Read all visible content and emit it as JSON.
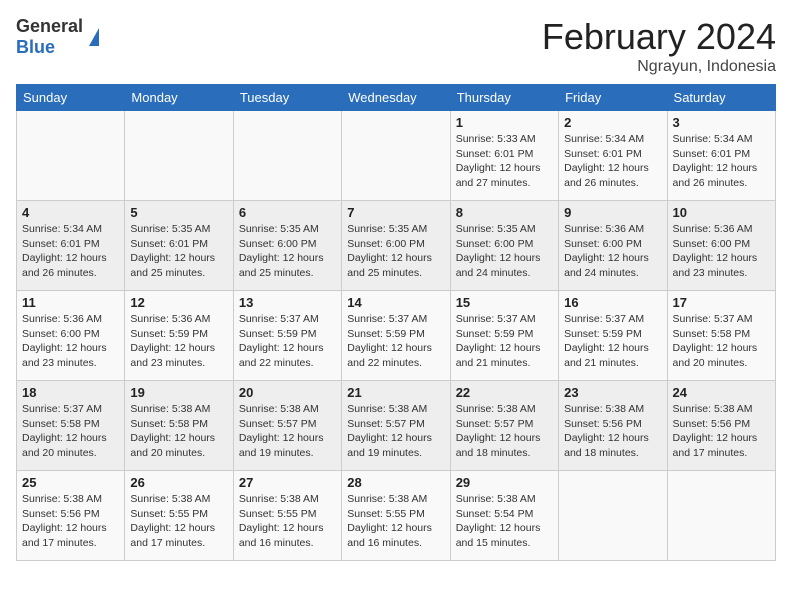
{
  "header": {
    "logo": {
      "general": "General",
      "blue": "Blue"
    },
    "title": "February 2024",
    "location": "Ngrayun, Indonesia"
  },
  "calendar": {
    "weekdays": [
      "Sunday",
      "Monday",
      "Tuesday",
      "Wednesday",
      "Thursday",
      "Friday",
      "Saturday"
    ],
    "weeks": [
      [
        {
          "day": "",
          "info": ""
        },
        {
          "day": "",
          "info": ""
        },
        {
          "day": "",
          "info": ""
        },
        {
          "day": "",
          "info": ""
        },
        {
          "day": "1",
          "info": "Sunrise: 5:33 AM\nSunset: 6:01 PM\nDaylight: 12 hours\nand 27 minutes."
        },
        {
          "day": "2",
          "info": "Sunrise: 5:34 AM\nSunset: 6:01 PM\nDaylight: 12 hours\nand 26 minutes."
        },
        {
          "day": "3",
          "info": "Sunrise: 5:34 AM\nSunset: 6:01 PM\nDaylight: 12 hours\nand 26 minutes."
        }
      ],
      [
        {
          "day": "4",
          "info": "Sunrise: 5:34 AM\nSunset: 6:01 PM\nDaylight: 12 hours\nand 26 minutes."
        },
        {
          "day": "5",
          "info": "Sunrise: 5:35 AM\nSunset: 6:01 PM\nDaylight: 12 hours\nand 25 minutes."
        },
        {
          "day": "6",
          "info": "Sunrise: 5:35 AM\nSunset: 6:00 PM\nDaylight: 12 hours\nand 25 minutes."
        },
        {
          "day": "7",
          "info": "Sunrise: 5:35 AM\nSunset: 6:00 PM\nDaylight: 12 hours\nand 25 minutes."
        },
        {
          "day": "8",
          "info": "Sunrise: 5:35 AM\nSunset: 6:00 PM\nDaylight: 12 hours\nand 24 minutes."
        },
        {
          "day": "9",
          "info": "Sunrise: 5:36 AM\nSunset: 6:00 PM\nDaylight: 12 hours\nand 24 minutes."
        },
        {
          "day": "10",
          "info": "Sunrise: 5:36 AM\nSunset: 6:00 PM\nDaylight: 12 hours\nand 23 minutes."
        }
      ],
      [
        {
          "day": "11",
          "info": "Sunrise: 5:36 AM\nSunset: 6:00 PM\nDaylight: 12 hours\nand 23 minutes."
        },
        {
          "day": "12",
          "info": "Sunrise: 5:36 AM\nSunset: 5:59 PM\nDaylight: 12 hours\nand 23 minutes."
        },
        {
          "day": "13",
          "info": "Sunrise: 5:37 AM\nSunset: 5:59 PM\nDaylight: 12 hours\nand 22 minutes."
        },
        {
          "day": "14",
          "info": "Sunrise: 5:37 AM\nSunset: 5:59 PM\nDaylight: 12 hours\nand 22 minutes."
        },
        {
          "day": "15",
          "info": "Sunrise: 5:37 AM\nSunset: 5:59 PM\nDaylight: 12 hours\nand 21 minutes."
        },
        {
          "day": "16",
          "info": "Sunrise: 5:37 AM\nSunset: 5:59 PM\nDaylight: 12 hours\nand 21 minutes."
        },
        {
          "day": "17",
          "info": "Sunrise: 5:37 AM\nSunset: 5:58 PM\nDaylight: 12 hours\nand 20 minutes."
        }
      ],
      [
        {
          "day": "18",
          "info": "Sunrise: 5:37 AM\nSunset: 5:58 PM\nDaylight: 12 hours\nand 20 minutes."
        },
        {
          "day": "19",
          "info": "Sunrise: 5:38 AM\nSunset: 5:58 PM\nDaylight: 12 hours\nand 20 minutes."
        },
        {
          "day": "20",
          "info": "Sunrise: 5:38 AM\nSunset: 5:57 PM\nDaylight: 12 hours\nand 19 minutes."
        },
        {
          "day": "21",
          "info": "Sunrise: 5:38 AM\nSunset: 5:57 PM\nDaylight: 12 hours\nand 19 minutes."
        },
        {
          "day": "22",
          "info": "Sunrise: 5:38 AM\nSunset: 5:57 PM\nDaylight: 12 hours\nand 18 minutes."
        },
        {
          "day": "23",
          "info": "Sunrise: 5:38 AM\nSunset: 5:56 PM\nDaylight: 12 hours\nand 18 minutes."
        },
        {
          "day": "24",
          "info": "Sunrise: 5:38 AM\nSunset: 5:56 PM\nDaylight: 12 hours\nand 17 minutes."
        }
      ],
      [
        {
          "day": "25",
          "info": "Sunrise: 5:38 AM\nSunset: 5:56 PM\nDaylight: 12 hours\nand 17 minutes."
        },
        {
          "day": "26",
          "info": "Sunrise: 5:38 AM\nSunset: 5:55 PM\nDaylight: 12 hours\nand 17 minutes."
        },
        {
          "day": "27",
          "info": "Sunrise: 5:38 AM\nSunset: 5:55 PM\nDaylight: 12 hours\nand 16 minutes."
        },
        {
          "day": "28",
          "info": "Sunrise: 5:38 AM\nSunset: 5:55 PM\nDaylight: 12 hours\nand 16 minutes."
        },
        {
          "day": "29",
          "info": "Sunrise: 5:38 AM\nSunset: 5:54 PM\nDaylight: 12 hours\nand 15 minutes."
        },
        {
          "day": "",
          "info": ""
        },
        {
          "day": "",
          "info": ""
        }
      ]
    ]
  }
}
